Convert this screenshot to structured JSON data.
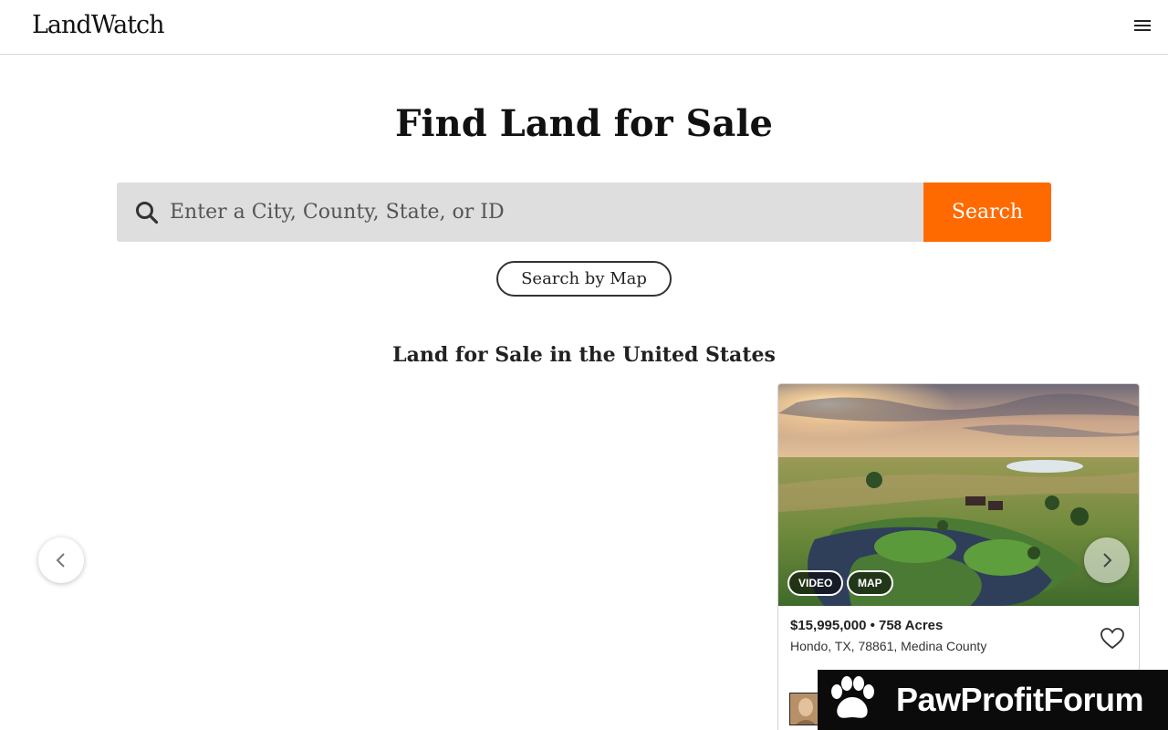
{
  "header": {
    "logo": "LandWatch"
  },
  "hero": {
    "title": "Find Land for Sale",
    "search_placeholder": "Enter a City, County, State, or ID",
    "search_label": "Search",
    "map_search_label": "Search by Map"
  },
  "section": {
    "title": "Land for Sale in the United States"
  },
  "listing": {
    "tags": [
      "VIDEO",
      "MAP"
    ],
    "price_acres": "$15,995,000 • 758 Acres",
    "location": "Hondo, TX, 78861, Medina County"
  },
  "watermark": {
    "text": "PawProfitForum"
  },
  "colors": {
    "accent": "#ff6a00",
    "search_bg": "#dedede",
    "text": "#111111"
  },
  "icons": {
    "menu": "hamburger-menu-icon",
    "search": "magnifier-icon",
    "prev": "chevron-left-icon",
    "next": "chevron-right-icon",
    "favorite": "heart-outline-icon"
  }
}
